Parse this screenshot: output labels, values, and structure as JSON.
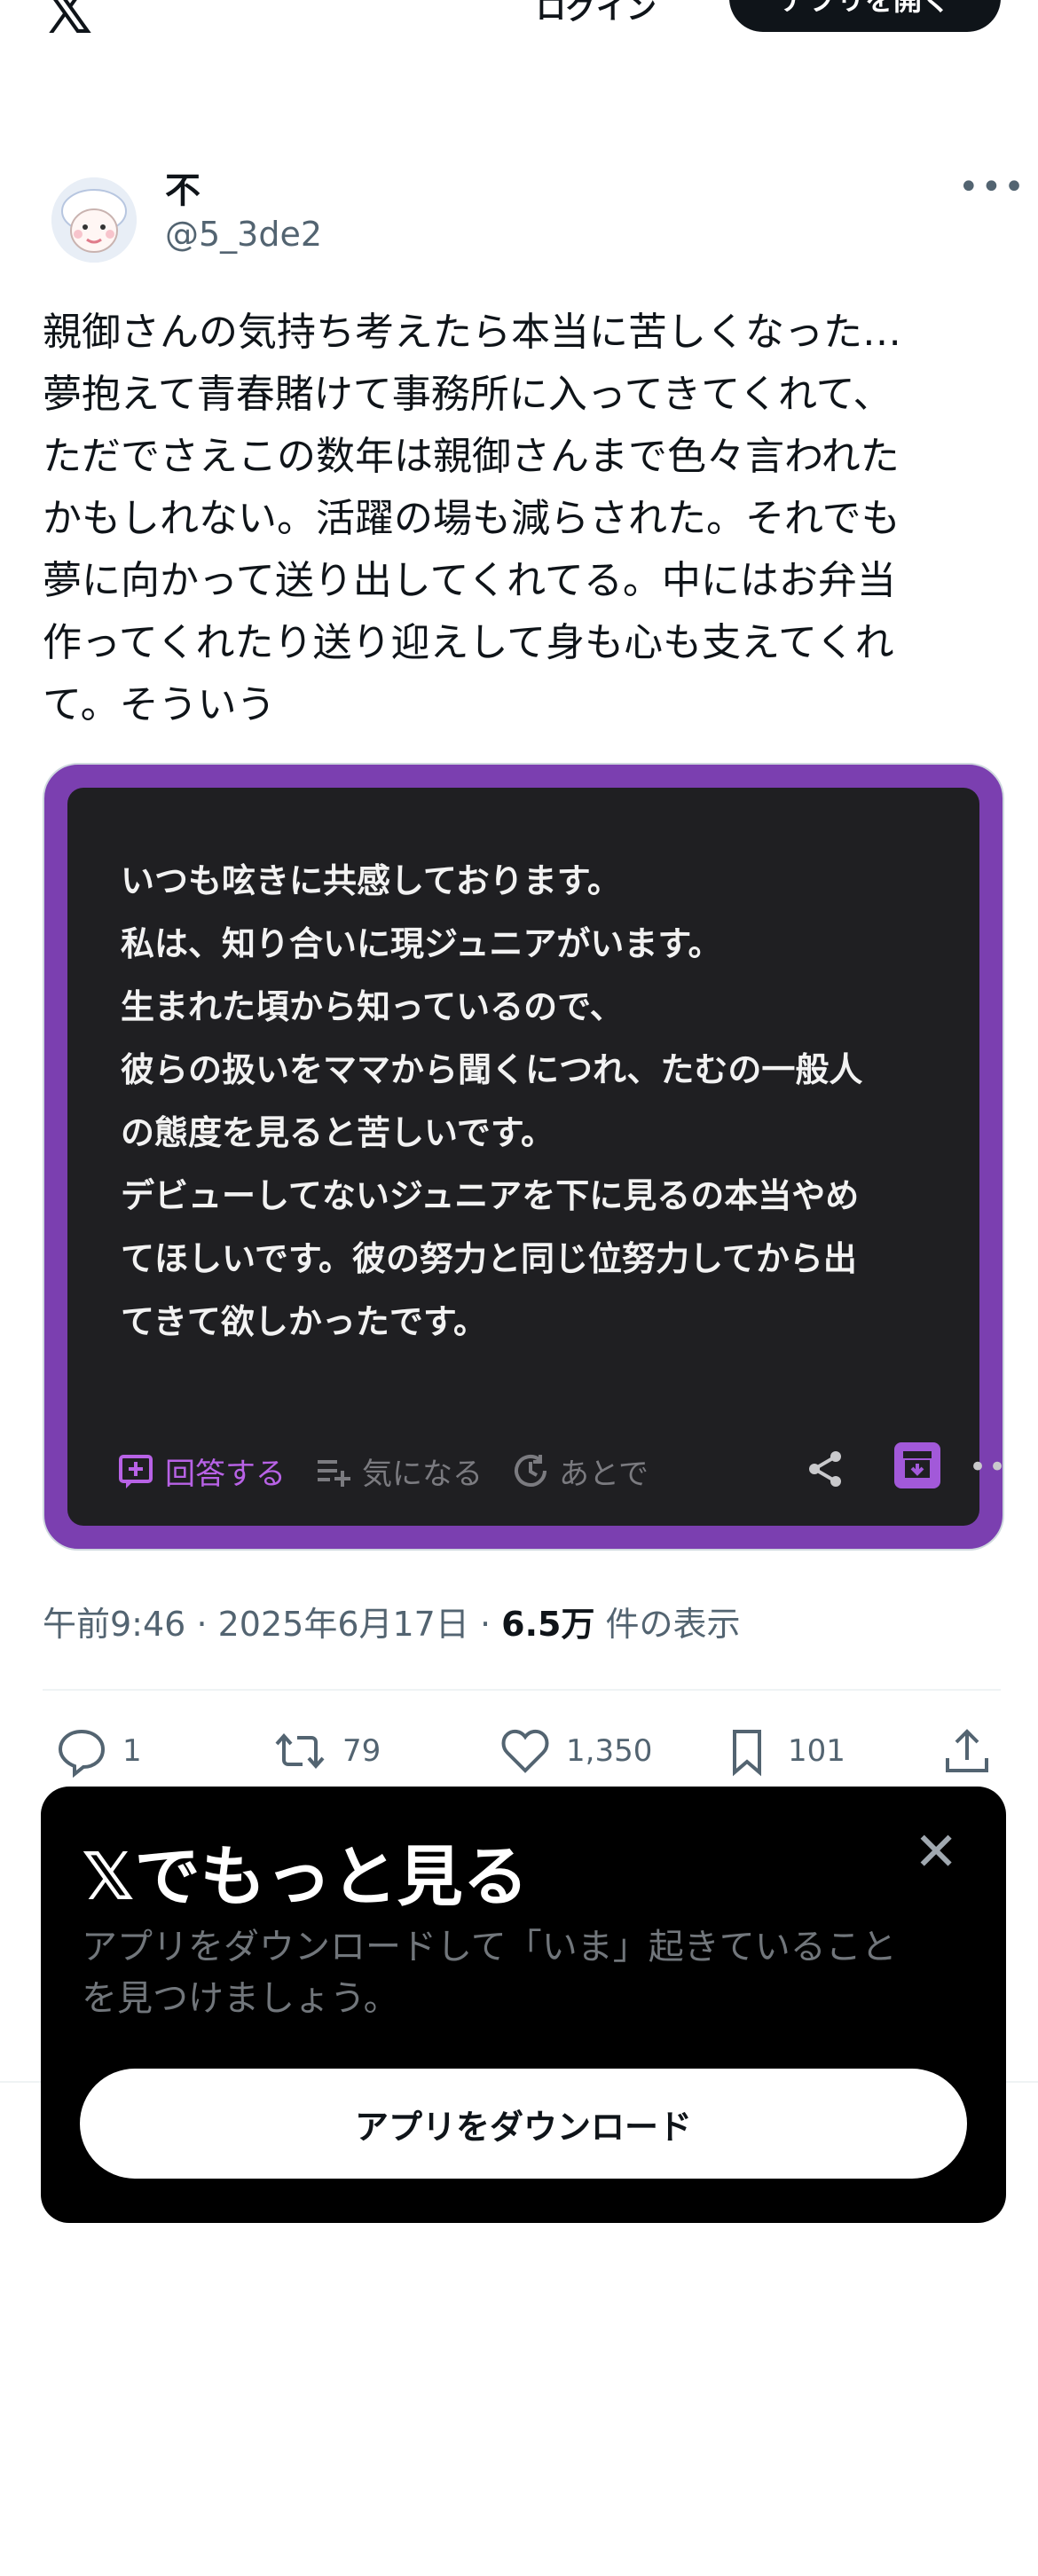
{
  "topbar": {
    "logo": "𝕏",
    "login_label": "ログイン",
    "open_app_label": "アプリを開く"
  },
  "author": {
    "name": "不",
    "handle": "@5_3de2"
  },
  "tweet": {
    "text": "親御さんの気持ち考えたら本当に苦しくなった…\n夢抱えて青春賭けて事務所に入ってきてくれて、\nただでさえこの数年は親御さんまで色々言われた\nかもしれない。活躍の場も減らされた。それでも\n夢に向かって送り出してくれてる。中にはお弁当\n作ってくれたり送り迎えして身も心も支えてくれ\nて。そういう"
  },
  "card": {
    "text": "いつも呟きに共感しております。\n私は、知り合いに現ジュニアがいます。\n生まれた頃から知っているので、\n彼らの扱いをママから聞くにつれ、たむの一般人\nの態度を見ると苦しいです。\nデビューしてないジュニアを下に見るの本当やめ\nてほしいです。彼の努力と同じ位努力してから出\nてきて欲しかったです。",
    "actions": {
      "answer": "回答する",
      "interested": "気になる",
      "later": "あとで"
    },
    "colors": {
      "frame": "#7b3fb0",
      "accent": "#b862e6",
      "panel": "#1f1f22"
    }
  },
  "meta": {
    "time": "午前9:46",
    "date": "2025年6月17日",
    "views": "6.5万",
    "views_suffix": "件の表示"
  },
  "stats": {
    "replies": "1",
    "retweets": "79",
    "likes": "1,350",
    "bookmarks": "101"
  },
  "sheet": {
    "title": "𝕏でもっと見る",
    "description": "アプリをダウンロードして「いま」起きていること\nを見つけましょう。",
    "button_label": "アプリをダウンロード"
  }
}
